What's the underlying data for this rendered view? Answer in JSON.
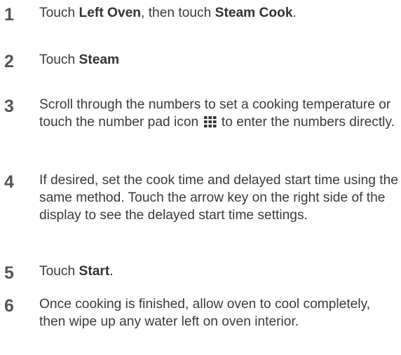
{
  "steps": [
    {
      "number": "1",
      "text_a": "Touch ",
      "bold_a": "Left Oven",
      "text_b": ", then touch ",
      "bold_b": "Steam Cook",
      "text_c": "."
    },
    {
      "number": "2",
      "text_a": "Touch ",
      "bold_a": "Steam"
    },
    {
      "number": "3",
      "text_a": "Scroll through the numbers to set a cooking temperature or touch the number pad icon ",
      "icon": "number-pad-icon",
      "text_b": " to enter the numbers directly."
    },
    {
      "number": "4",
      "text_a": "If desired, set the cook time and delayed start time using the same method. Touch the arrow key on the right side of the display to see the delayed start time settings."
    },
    {
      "number": "5",
      "text_a": "Touch ",
      "bold_a": "Start",
      "text_b": "."
    },
    {
      "number": "6",
      "text_a": "Once cooking is finished, allow oven to cool completely, then wipe up any water left on oven interior."
    }
  ]
}
